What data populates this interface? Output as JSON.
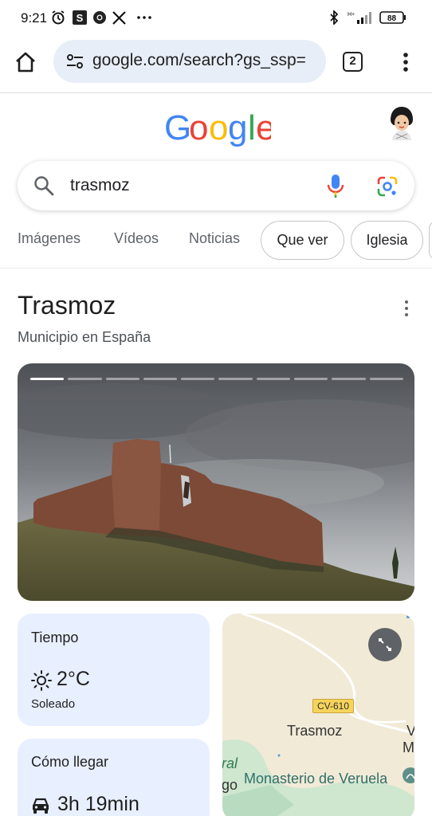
{
  "status_bar": {
    "time": "9:21",
    "battery": "88",
    "network": "H+"
  },
  "browser": {
    "url": "google.com/search?gs_ssp=",
    "tab_count": "2"
  },
  "search": {
    "query": "trasmoz"
  },
  "filters": {
    "tabs": [
      "Imágenes",
      "Vídeos",
      "Noticias"
    ],
    "chips": [
      "Que ver",
      "Iglesia"
    ]
  },
  "knowledge_panel": {
    "title": "Trasmoz",
    "subtitle": "Municipio en España",
    "gallery_slides": 10,
    "gallery_active_index": 0
  },
  "weather_card": {
    "title": "Tiempo",
    "temperature": "2°C",
    "condition": "Soleado"
  },
  "directions_card": {
    "title": "Cómo llegar",
    "duration": "3h 19min"
  },
  "map_card": {
    "road_label": "CV-610",
    "town_label": "Trasmoz",
    "poi_label": "Monasterio de Veruela",
    "edge_fragments": [
      "ral",
      "go",
      "V",
      "M"
    ]
  },
  "colors": {
    "google_blue": "#4285F4",
    "google_red": "#EA4335",
    "google_yellow": "#FBBC05",
    "google_green": "#34A853",
    "card_background": "#e8efff",
    "url_pill": "#e8eef7"
  }
}
